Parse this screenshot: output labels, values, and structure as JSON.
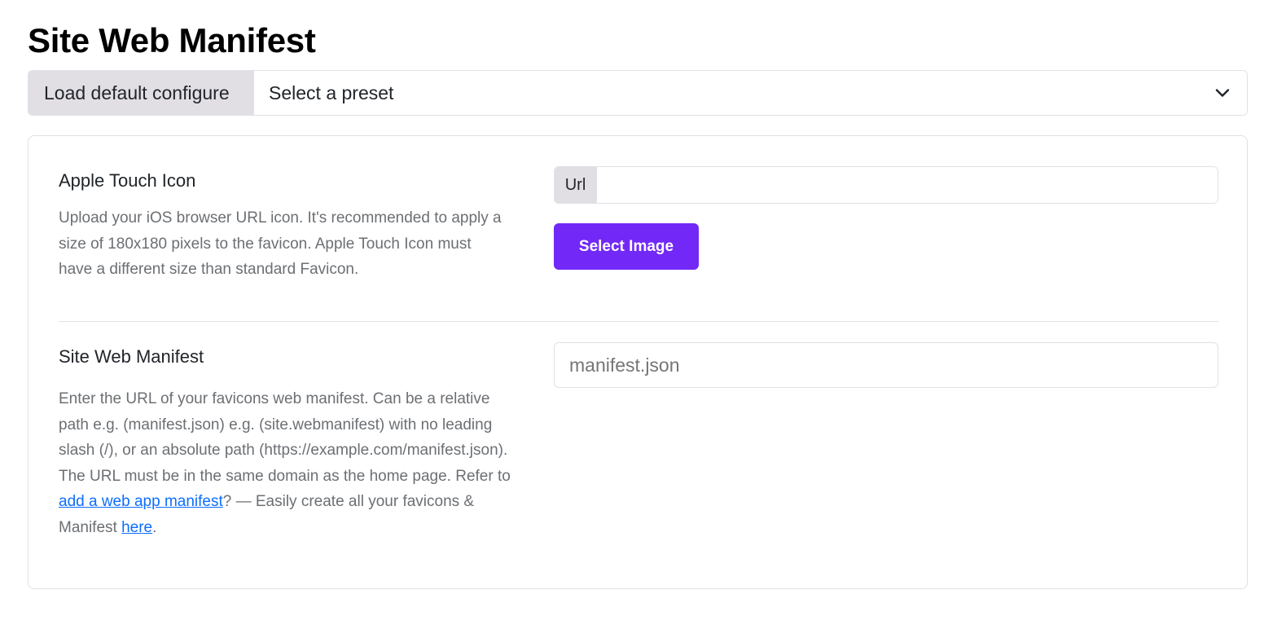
{
  "page": {
    "title": "Site Web Manifest"
  },
  "preset": {
    "label": "Load default configure",
    "selected": "Select a preset"
  },
  "apple_touch": {
    "title": "Apple Touch Icon",
    "description": "Upload your iOS browser URL icon. It's recommended to apply a size of 180x180 pixels to the favicon. Apple Touch Icon must have a different size than standard Favicon.",
    "url_addon": "Url",
    "url_value": "",
    "select_button": "Select Image"
  },
  "manifest": {
    "title": "Site Web Manifest",
    "desc_part1": "Enter the URL of your favicons web manifest. Can be a relative path e.g. (manifest.json) e.g. (site.webmanifest) with no leading slash (/), or an absolute path (https://example.com/manifest.json). The URL must be in the same domain as the home page. Refer to ",
    "link1": "add a web app manifest",
    "desc_part2": "? — Easily create all your favicons & Manifest ",
    "link2": "here",
    "desc_part3": ".",
    "placeholder": "manifest.json"
  },
  "colors": {
    "accent": "#7228f7",
    "link": "#0d6efd",
    "addon_bg": "#e2dfe4"
  },
  "icons": {
    "dropdown": "chevron-down-icon"
  }
}
